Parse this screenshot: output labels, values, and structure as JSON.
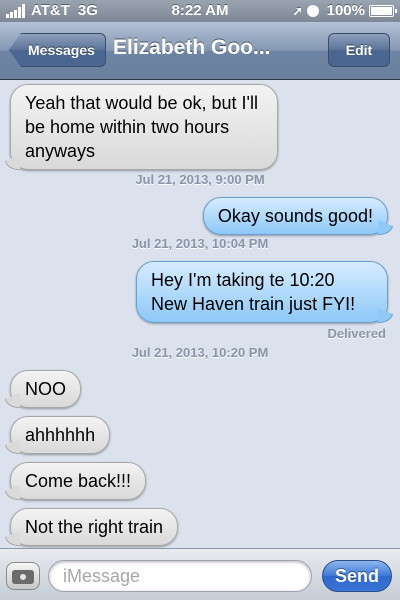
{
  "status_bar": {
    "carrier": "AT&T",
    "network": "3G",
    "time": "8:22 AM",
    "battery": "100%",
    "battery_level": 1.0,
    "signal_bars": 5
  },
  "nav": {
    "back_label": "Messages",
    "title": "Elizabeth Goo...",
    "edit_label": "Edit"
  },
  "messages": [
    {
      "type": "incoming",
      "text": "Yeah that would be ok, but I'll be home within two hours anyways"
    },
    {
      "type": "timestamp",
      "text": "Jul 21, 2013, 9:00 PM"
    },
    {
      "type": "outgoing",
      "text": "Okay sounds good!"
    },
    {
      "type": "timestamp",
      "text": "Jul 21, 2013, 10:04 PM"
    },
    {
      "type": "outgoing",
      "text": "Hey I'm taking te 10:20 New Haven train just FYI!"
    },
    {
      "type": "status",
      "text": "Delivered"
    },
    {
      "type": "timestamp",
      "text": "Jul 21, 2013, 10:20 PM"
    },
    {
      "type": "incoming",
      "text": "NOO"
    },
    {
      "type": "incoming",
      "text": "ahhhhhh"
    },
    {
      "type": "incoming",
      "text": "Come back!!!"
    },
    {
      "type": "incoming",
      "text": "Not the right train"
    }
  ],
  "composer": {
    "placeholder": "iMessage",
    "value": "",
    "send_label": "Send",
    "camera_icon": "camera-icon"
  },
  "colors": {
    "background": "#dbe2ed",
    "incoming_bubble": "#e6e6e6",
    "outgoing_bubble": "#9fd0fa",
    "nav_bar": "#7d92b0",
    "send_button": "#3a74d4"
  }
}
